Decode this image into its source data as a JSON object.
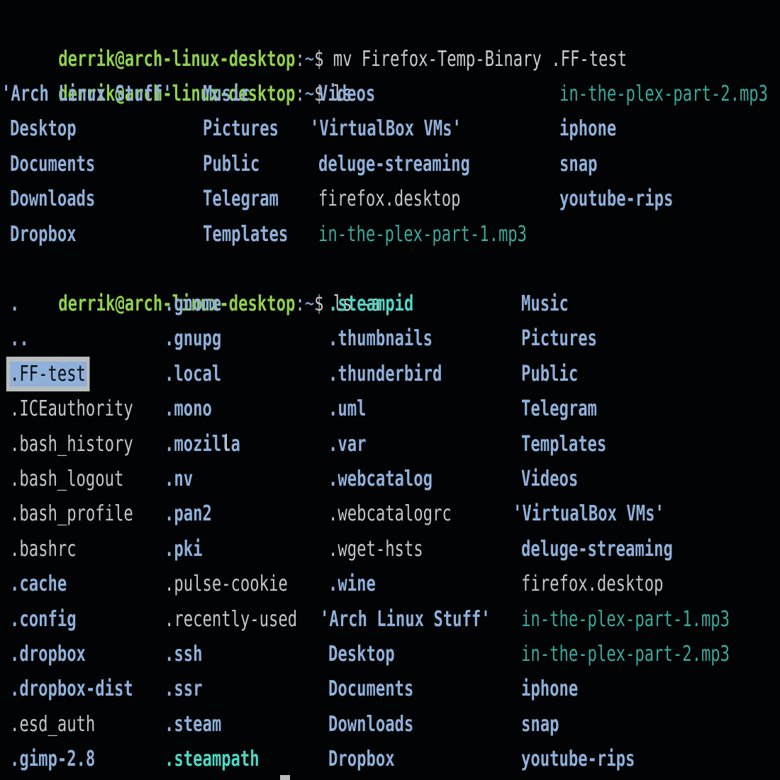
{
  "terminal": {
    "prompt": {
      "user_host": "derrik@arch-linux-desktop",
      "sep": ":",
      "path": "~",
      "symbol": "$"
    },
    "colors": {
      "prompt": "#8fd14f",
      "directory": "#8fb0d9",
      "file": "#c4c6c8",
      "audio": "#3ba99a",
      "symlink": "#4fd6c4",
      "selection": "#8fb0d9"
    },
    "commands": [
      " mv Firefox-Temp-Binary .FF-test",
      " ls",
      " ls -a"
    ],
    "ls_output": {
      "rows": [
        [
          {
            "t": "'Arch Linux Stuff'",
            "k": "dir"
          },
          {
            "t": "Music",
            "k": "dir"
          },
          {
            "t": "Videos",
            "k": "dir"
          },
          {
            "t": "in-the-plex-part-2.mp3",
            "k": "audio"
          }
        ],
        [
          {
            "t": "Desktop",
            "k": "dir"
          },
          {
            "t": "Pictures",
            "k": "dir"
          },
          {
            "t": "'VirtualBox VMs'",
            "k": "dir"
          },
          {
            "t": "iphone",
            "k": "dir"
          }
        ],
        [
          {
            "t": "Documents",
            "k": "dir"
          },
          {
            "t": "Public",
            "k": "dir"
          },
          {
            "t": "deluge-streaming",
            "k": "dir"
          },
          {
            "t": "snap",
            "k": "dir"
          }
        ],
        [
          {
            "t": "Downloads",
            "k": "dir"
          },
          {
            "t": "Telegram",
            "k": "dir"
          },
          {
            "t": "firefox.desktop",
            "k": "file"
          },
          {
            "t": "youtube-rips",
            "k": "dir"
          }
        ],
        [
          {
            "t": "Dropbox",
            "k": "dir"
          },
          {
            "t": "Templates",
            "k": "dir"
          },
          {
            "t": "in-the-plex-part-1.mp3",
            "k": "audio"
          },
          {
            "t": "",
            "k": "file"
          }
        ]
      ]
    },
    "ls_a_output": {
      "rows": [
        [
          {
            "t": ".",
            "k": "dir"
          },
          {
            "t": ".gnome",
            "k": "dir"
          },
          {
            "t": ".steampid",
            "k": "link"
          },
          {
            "t": "Music",
            "k": "dir"
          }
        ],
        [
          {
            "t": "..",
            "k": "dir"
          },
          {
            "t": ".gnupg",
            "k": "dir"
          },
          {
            "t": ".thumbnails",
            "k": "dir"
          },
          {
            "t": "Pictures",
            "k": "dir"
          }
        ],
        [
          {
            "t": ".FF-test",
            "k": "sel"
          },
          {
            "t": ".local",
            "k": "dir"
          },
          {
            "t": ".thunderbird",
            "k": "dir"
          },
          {
            "t": "Public",
            "k": "dir"
          }
        ],
        [
          {
            "t": ".ICEauthority",
            "k": "file"
          },
          {
            "t": ".mono",
            "k": "dir"
          },
          {
            "t": ".uml",
            "k": "dir"
          },
          {
            "t": "Telegram",
            "k": "dir"
          }
        ],
        [
          {
            "t": ".bash_history",
            "k": "file"
          },
          {
            "t": ".mozilla",
            "k": "dir"
          },
          {
            "t": ".var",
            "k": "dir"
          },
          {
            "t": "Templates",
            "k": "dir"
          }
        ],
        [
          {
            "t": ".bash_logout",
            "k": "file"
          },
          {
            "t": ".nv",
            "k": "dir"
          },
          {
            "t": ".webcatalog",
            "k": "dir"
          },
          {
            "t": "Videos",
            "k": "dir"
          }
        ],
        [
          {
            "t": ".bash_profile",
            "k": "file"
          },
          {
            "t": ".pan2",
            "k": "dir"
          },
          {
            "t": ".webcatalogrc",
            "k": "file"
          },
          {
            "t": "'VirtualBox VMs'",
            "k": "dir"
          }
        ],
        [
          {
            "t": ".bashrc",
            "k": "file"
          },
          {
            "t": ".pki",
            "k": "dir"
          },
          {
            "t": ".wget-hsts",
            "k": "file"
          },
          {
            "t": "deluge-streaming",
            "k": "dir"
          }
        ],
        [
          {
            "t": ".cache",
            "k": "dir"
          },
          {
            "t": ".pulse-cookie",
            "k": "file"
          },
          {
            "t": ".wine",
            "k": "dir"
          },
          {
            "t": "firefox.desktop",
            "k": "file"
          }
        ],
        [
          {
            "t": ".config",
            "k": "dir"
          },
          {
            "t": ".recently-used",
            "k": "file"
          },
          {
            "t": "'Arch Linux Stuff'",
            "k": "dir"
          },
          {
            "t": "in-the-plex-part-1.mp3",
            "k": "audio"
          }
        ],
        [
          {
            "t": ".dropbox",
            "k": "dir"
          },
          {
            "t": ".ssh",
            "k": "dir"
          },
          {
            "t": "Desktop",
            "k": "dir"
          },
          {
            "t": "in-the-plex-part-2.mp3",
            "k": "audio"
          }
        ],
        [
          {
            "t": ".dropbox-dist",
            "k": "dir"
          },
          {
            "t": ".ssr",
            "k": "dir"
          },
          {
            "t": "Documents",
            "k": "dir"
          },
          {
            "t": "iphone",
            "k": "dir"
          }
        ],
        [
          {
            "t": ".esd_auth",
            "k": "file"
          },
          {
            "t": ".steam",
            "k": "dir"
          },
          {
            "t": "Downloads",
            "k": "dir"
          },
          {
            "t": "snap",
            "k": "dir"
          }
        ],
        [
          {
            "t": ".gimp-2.8",
            "k": "dir"
          },
          {
            "t": ".steampath",
            "k": "link"
          },
          {
            "t": "Dropbox",
            "k": "dir"
          },
          {
            "t": "youtube-rips",
            "k": "dir"
          }
        ]
      ]
    }
  }
}
